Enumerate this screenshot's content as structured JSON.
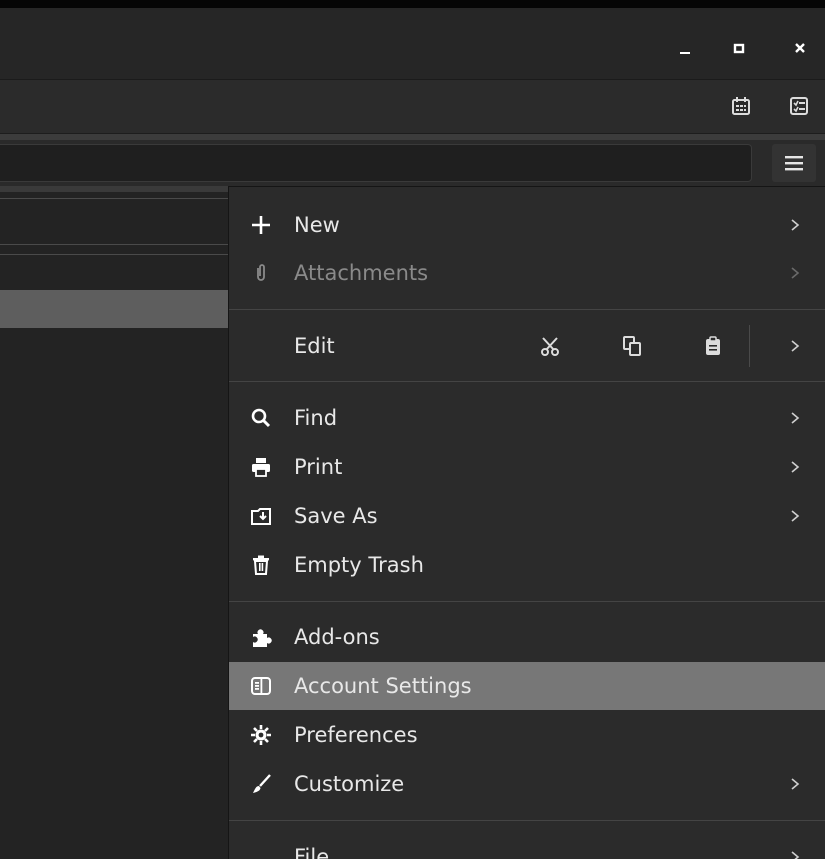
{
  "window": {
    "minimize_icon": "minimize-icon",
    "maximize_icon": "maximize-icon",
    "close_icon": "close-icon"
  },
  "toolbar": {
    "icons": [
      "calendar-icon",
      "tasks-icon"
    ]
  },
  "app_menu": {
    "button_icon": "hamburger-menu-icon",
    "items": [
      {
        "label": "New",
        "icon": "plus-icon",
        "submenu": true,
        "enabled": true
      },
      {
        "label": "Attachments",
        "icon": "paperclip-icon",
        "submenu": true,
        "enabled": false
      },
      {
        "label": "Find",
        "icon": "search-icon",
        "submenu": true,
        "enabled": true
      },
      {
        "label": "Print",
        "icon": "printer-icon",
        "submenu": true,
        "enabled": true
      },
      {
        "label": "Save As",
        "icon": "save-as-icon",
        "submenu": true,
        "enabled": true
      },
      {
        "label": "Empty Trash",
        "icon": "trash-icon",
        "submenu": false,
        "enabled": true
      },
      {
        "label": "Add-ons",
        "icon": "puzzle-icon",
        "submenu": false,
        "enabled": true
      },
      {
        "label": "Account Settings",
        "icon": "account-settings-icon",
        "submenu": false,
        "enabled": true,
        "highlighted": true
      },
      {
        "label": "Preferences",
        "icon": "gear-icon",
        "submenu": false,
        "enabled": true
      },
      {
        "label": "Customize",
        "icon": "brush-icon",
        "submenu": true,
        "enabled": true
      },
      {
        "label": "File",
        "icon": "",
        "submenu": true,
        "enabled": true
      }
    ],
    "edit": {
      "label": "Edit",
      "buttons": [
        "cut-icon",
        "copy-icon",
        "paste-icon"
      ]
    }
  },
  "colors": {
    "menu_bg": "#2b2b2b",
    "highlight": "#777777",
    "text": "#e8e8e8",
    "disabled_text": "#8a8a8a"
  }
}
